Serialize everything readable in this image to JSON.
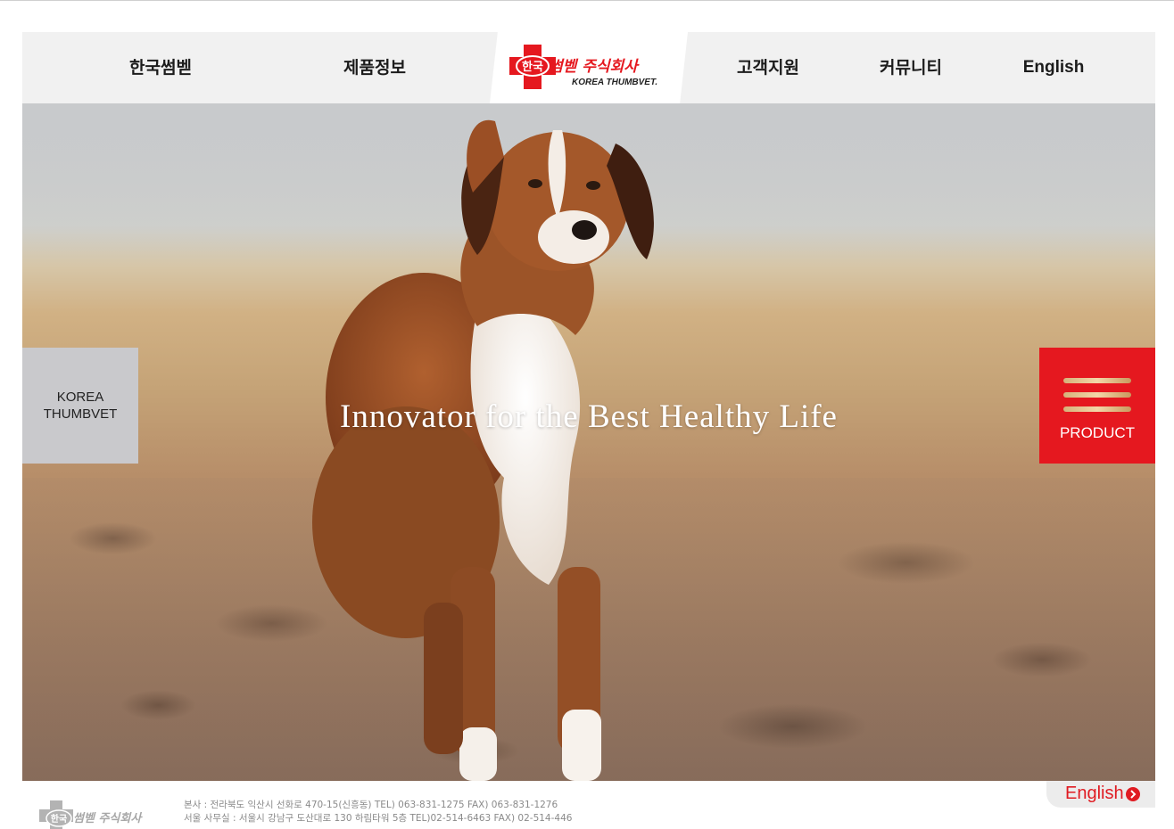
{
  "nav": {
    "items": [
      {
        "label": "한국썸벧"
      },
      {
        "label": "제품정보"
      },
      {
        "label": "고객지원"
      },
      {
        "label": "커뮤니티"
      },
      {
        "label": "English"
      }
    ]
  },
  "logo": {
    "text_ko": "한국썸벧 주식회사",
    "text_en": "KOREA THUMBVET."
  },
  "hero": {
    "tagline": "Innovator for the Best Healthy Life"
  },
  "side_left": {
    "label": "KOREA\nTHUMBVET"
  },
  "side_right": {
    "label": "PRODUCT"
  },
  "footer": {
    "logo_text": "한국썸벧 주식회사",
    "address_lines": [
      "본사 : 전라북도 익산시 선화로 470-15(신흥동) TEL) 063-831-1275 FAX) 063-831-1276",
      "서울 사무실 : 서울시 강남구 도산대로 130 하림타워 5층 TEL)02-514-6463 FAX) 02-514-446"
    ],
    "english_label": "English"
  },
  "colors": {
    "brand_red": "#e5181f",
    "nav_bg": "#f1f1f1",
    "side_left_bg": "#c9c9cc"
  }
}
